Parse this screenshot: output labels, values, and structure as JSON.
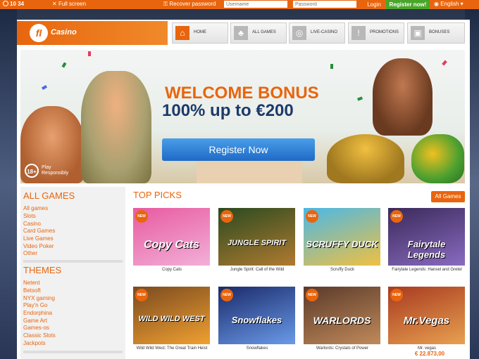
{
  "topbar": {
    "clock": "10 34",
    "fullscreen": "Full screen",
    "recover": "Recover password",
    "username_placeholder": "Username",
    "password_placeholder": "Password",
    "login": "Login",
    "register": "Register now!",
    "language": "English"
  },
  "logo": {
    "mark": "fl",
    "text": "Casino"
  },
  "nav": [
    {
      "label": "HOME",
      "icon": "home-icon"
    },
    {
      "label": "ALL GAMES",
      "icon": "clubs-icon"
    },
    {
      "label": "LIVE-CASINO",
      "icon": "chip-icon"
    },
    {
      "label": "PROMOTIONS",
      "icon": "exclamation-icon"
    },
    {
      "label": "BONUSES",
      "icon": "gift-icon"
    }
  ],
  "banner": {
    "line1": "WELCOME BONUS",
    "line2": "100% up to €200",
    "cta": "Register Now",
    "rg_badge": "18+",
    "rg_text": "Play Responsibly"
  },
  "sidebar": {
    "all_games_title": "ALL GAMES",
    "all_games": [
      "All games",
      "Slots",
      "Casino",
      "Card Games",
      "Live Games",
      "Video Poker",
      "Other"
    ],
    "themes_title": "THEMES",
    "themes": [
      "Netent",
      "Betsoft",
      "NYX gaming",
      "Play'n Go",
      "Endorphina",
      "Game Art",
      "Games-os",
      "Classic Slots",
      "Jackpots"
    ]
  },
  "main": {
    "title": "TOP PICKS",
    "all_games_button": "All Games",
    "new_badge": "NEW",
    "games": [
      {
        "name": "Copy Cats",
        "art": "Copy Cats",
        "colors": [
          "#e85aa0",
          "#f2b0d8"
        ]
      },
      {
        "name": "Jungle Spirit: Call of the Wild",
        "art": "JUNGLE SPIRIT",
        "colors": [
          "#2a4a20",
          "#b07a30"
        ]
      },
      {
        "name": "Scruffy Duck",
        "art": "SCRUFFY DUCK",
        "colors": [
          "#4ab8e8",
          "#f0c040"
        ]
      },
      {
        "name": "Fairytale Legends: Hansel and Gretel",
        "art": "Fairytale Legends",
        "colors": [
          "#3a2a5a",
          "#8a6ac0"
        ]
      },
      {
        "name": "Wild Wild West: The Great Train Heist",
        "art": "WILD WILD WEST",
        "colors": [
          "#7a4a20",
          "#f0a030"
        ]
      },
      {
        "name": "Snowflakes",
        "art": "Snowflakes",
        "colors": [
          "#1a2a6a",
          "#6a9ae8"
        ]
      },
      {
        "name": "Warlords: Crystals of Power",
        "art": "WARLORDS",
        "colors": [
          "#5a3a2a",
          "#c08a5a"
        ]
      },
      {
        "name": "Mr. vegas",
        "art": "Mr.Vegas",
        "colors": [
          "#a83a20",
          "#e8a050"
        ]
      }
    ],
    "jackpot": "€ 22.873,00"
  }
}
